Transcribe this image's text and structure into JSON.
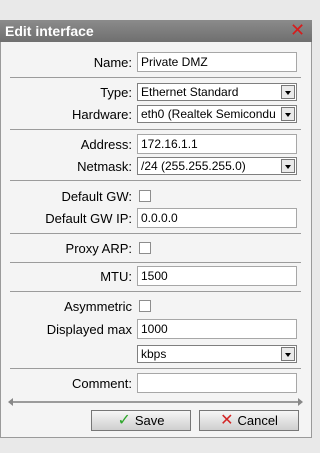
{
  "dialog": {
    "title": "Edit interface",
    "close_icon": "close-icon"
  },
  "fields": {
    "name": {
      "label": "Name:",
      "value": "Private DMZ"
    },
    "type": {
      "label": "Type:",
      "value": "Ethernet Standard"
    },
    "hardware": {
      "label": "Hardware:",
      "value": "eth0 (Realtek Semicondu"
    },
    "address": {
      "label": "Address:",
      "value": "172.16.1.1"
    },
    "netmask": {
      "label": "Netmask:",
      "value": "/24 (255.255.255.0)"
    },
    "default_gw": {
      "label": "Default GW:",
      "checked": false
    },
    "default_gw_ip": {
      "label": "Default GW IP:",
      "value": "0.0.0.0"
    },
    "proxy_arp": {
      "label": "Proxy ARP:",
      "checked": false
    },
    "mtu": {
      "label": "MTU:",
      "value": "1500"
    },
    "asymmetric": {
      "label": "Asymmetric",
      "checked": false
    },
    "displayed_max": {
      "label": "Displayed max",
      "value": "1000"
    },
    "unit": {
      "value": "kbps"
    },
    "comment": {
      "label": "Comment:",
      "value": ""
    }
  },
  "buttons": {
    "save": "Save",
    "cancel": "Cancel"
  },
  "colors": {
    "titlebar": "#7d7d7d",
    "save_icon": "#2da62a",
    "cancel_icon": "#d32525"
  }
}
